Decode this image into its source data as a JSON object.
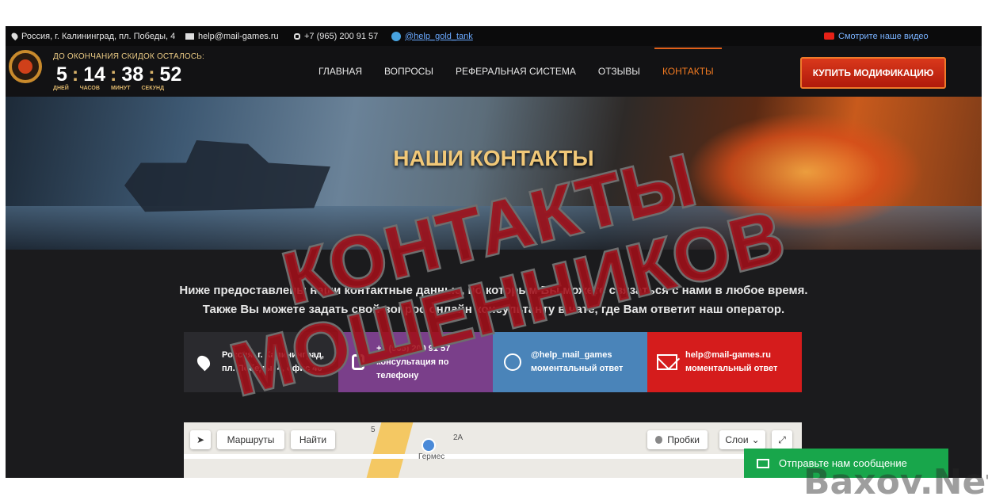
{
  "topbar": {
    "address": "Россия, г. Калининград, пл. Победы, 4",
    "email": "help@mail-games.ru",
    "phone": "+7 (965) 200 91 57",
    "telegram": "@help_gold_tank",
    "video_link": "Смотрите наше видео"
  },
  "timer": {
    "label": "ДО ОКОНЧАНИЯ СКИДОК ОСТАЛОСЬ:",
    "days": "5",
    "hours": "14",
    "minutes": "38",
    "seconds": "52",
    "unit_days": "ДНЕЙ",
    "unit_hours": "ЧАСОВ",
    "unit_minutes": "МИНУТ",
    "unit_seconds": "СЕКУНД"
  },
  "nav": {
    "items": [
      "ГЛАВНАЯ",
      "ВОПРОСЫ",
      "РЕФЕРАЛЬНАЯ СИСТЕМА",
      "ОТЗЫВЫ",
      "КОНТАКТЫ"
    ],
    "active": "КОНТАКТЫ",
    "buy_button": "КУПИТЬ МОДИФИКАЦИЮ"
  },
  "hero": {
    "title": "НАШИ КОНТАКТЫ"
  },
  "intro": {
    "line1": "Ниже предоставлены наши контактные данные, по которым Вы можете связаться с нами в любое время.",
    "line2": "Также Вы можете задать свой вопрос онлайн консультанту в чате, где Вам ответит наш оператор."
  },
  "contacts": [
    {
      "line1": "Россия, г. Калининград,",
      "line2": "пл. Победы, 4, офис 46",
      "icon": "location-pin-icon"
    },
    {
      "line1": "+7 (965) 200 91 57",
      "line2": "консультация по телефону",
      "icon": "phone-icon"
    },
    {
      "line1": "@help_mail_games",
      "line2": "моментальный ответ",
      "icon": "telegram-icon"
    },
    {
      "line1": "help@mail-games.ru",
      "line2": "моментальный ответ",
      "icon": "mail-icon"
    }
  ],
  "map": {
    "routes_button": "Маршруты",
    "find_button": "Найти",
    "traffic_button": "Пробки",
    "layers_button": "Слои",
    "place_label": "Гермес",
    "label_2a": "2А",
    "label_5": "5"
  },
  "chat": {
    "label": "Отправьте нам сообщение"
  },
  "overlay": {
    "stamp_line1": "КОНТАКТЫ",
    "stamp_line2": "МОШЕННИКОВ",
    "watermark": "Baxov.Net"
  },
  "colors": {
    "accent_orange": "#f27a21",
    "buy_red": "#d9381b",
    "card_phone": "#7a3f8a",
    "card_telegram": "#4a84b9",
    "card_mail": "#d51c1c",
    "chat_green": "#18a64b"
  }
}
